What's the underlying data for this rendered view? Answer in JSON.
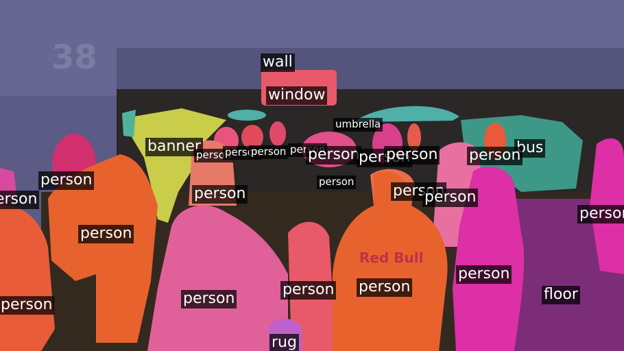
{
  "segments": [
    {
      "label": "wall",
      "color": "#5e5e8f"
    },
    {
      "label": "window",
      "color": "#e85a6a"
    },
    {
      "label": "umbrella",
      "color": "#4fb0a8"
    },
    {
      "label": "banner",
      "color": "#c9cd4a"
    },
    {
      "label": "bus",
      "color": "#4fb39a"
    },
    {
      "label": "floor",
      "color": "#8a2f86"
    },
    {
      "label": "rug",
      "color": "#c061c9"
    },
    {
      "label": "person",
      "color": "#e8622d"
    }
  ],
  "labels": {
    "wall": "wall",
    "window": "window",
    "umbrella": "umbrella",
    "banner": "banner",
    "bus": "bus",
    "floor": "floor",
    "rug": "rug",
    "p1": "person",
    "p2": "person",
    "p3": "person",
    "p4": "person",
    "p5": "person",
    "p6": "person",
    "p7": "person",
    "p8": "person",
    "p9": "person",
    "p10": "person",
    "p11": "person",
    "p12": "person",
    "p13": "person",
    "p14": "person",
    "p15": "person",
    "p16": "person",
    "p17": "person",
    "p18": "person",
    "p19": "person",
    "p20": "person"
  },
  "background_text": {
    "garage_number": "38",
    "shirt_logo": "Red Bull"
  }
}
